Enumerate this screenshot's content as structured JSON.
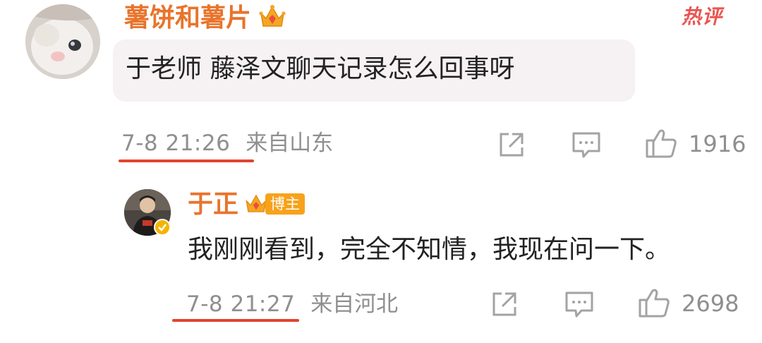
{
  "badge": {
    "hot": "热评"
  },
  "comment": {
    "username": "薯饼和薯片",
    "text": "于老师 藤泽文聊天记录怎么回事呀",
    "time": "7-8 21:26",
    "location": "来自山东",
    "likes": "1916",
    "icons": [
      "vip-crown-icon",
      "share-icon",
      "comment-icon",
      "like-icon"
    ]
  },
  "reply": {
    "username": "于正",
    "author_tag": "博主",
    "text": "我刚刚看到，完全不知情，我现在问一下。",
    "time": "7-8 21:27",
    "location": "来自河北",
    "likes": "2698",
    "icons": [
      "vip-crown-icon",
      "verified-icon",
      "share-icon",
      "comment-icon",
      "like-icon"
    ]
  },
  "colors": {
    "username": "#e8742c",
    "underline": "#e2432f",
    "hot": "#ea5552",
    "author_tag": "#f7a21b",
    "bubble": "#f6f1f3",
    "meta": "#8f8f8f"
  }
}
